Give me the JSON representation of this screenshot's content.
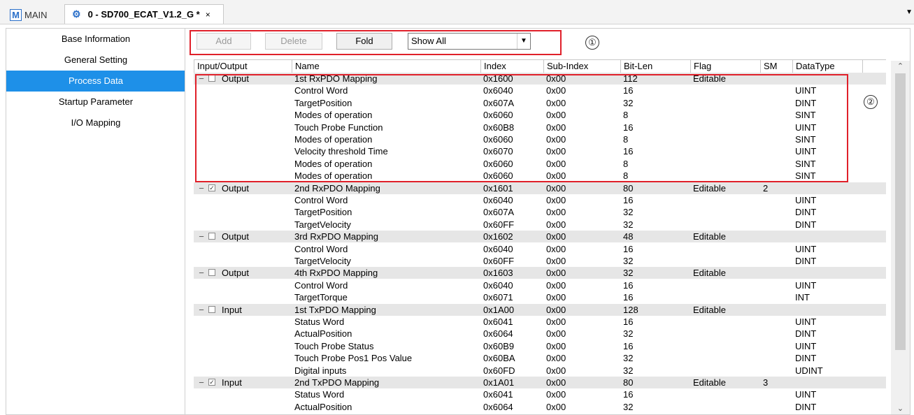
{
  "tabs": {
    "main_label": "MAIN",
    "active_label": "0 - SD700_ECAT_V1.2_G *",
    "close_glyph": "×"
  },
  "sidebar": {
    "items": [
      {
        "label": "Base Information",
        "active": false
      },
      {
        "label": "General Setting",
        "active": false
      },
      {
        "label": "Process Data",
        "active": true
      },
      {
        "label": "Startup Parameter",
        "active": false
      },
      {
        "label": "I/O Mapping",
        "active": false
      }
    ]
  },
  "toolbar": {
    "add_label": "Add",
    "delete_label": "Delete",
    "fold_label": "Fold",
    "filter_value": "Show All"
  },
  "markers": {
    "one": "①",
    "two": "②"
  },
  "accent_color": "#1e90e8",
  "highlight_color": "#e0202a",
  "table": {
    "columns": [
      "Input/Output",
      "Name",
      "Index",
      "Sub-Index",
      "Bit-Len",
      "Flag",
      "SM",
      "DataType"
    ],
    "rows": [
      {
        "group": true,
        "checked": false,
        "io": "Output",
        "name": "1st RxPDO Mapping",
        "index": "0x1600",
        "sub": "0x00",
        "bits": "112",
        "flag": "Editable",
        "sm": "",
        "type": ""
      },
      {
        "group": false,
        "io": "",
        "name": "Control Word",
        "index": "0x6040",
        "sub": "0x00",
        "bits": "16",
        "flag": "",
        "sm": "",
        "type": "UINT"
      },
      {
        "group": false,
        "io": "",
        "name": "TargetPosition",
        "index": "0x607A",
        "sub": "0x00",
        "bits": "32",
        "flag": "",
        "sm": "",
        "type": "DINT"
      },
      {
        "group": false,
        "io": "",
        "name": "Modes of operation",
        "index": "0x6060",
        "sub": "0x00",
        "bits": "8",
        "flag": "",
        "sm": "",
        "type": "SINT"
      },
      {
        "group": false,
        "io": "",
        "name": "Touch Probe Function",
        "index": "0x60B8",
        "sub": "0x00",
        "bits": "16",
        "flag": "",
        "sm": "",
        "type": "UINT"
      },
      {
        "group": false,
        "io": "",
        "name": "Modes of operation",
        "index": "0x6060",
        "sub": "0x00",
        "bits": "8",
        "flag": "",
        "sm": "",
        "type": "SINT"
      },
      {
        "group": false,
        "io": "",
        "name": "Velocity threshold Time",
        "index": "0x6070",
        "sub": "0x00",
        "bits": "16",
        "flag": "",
        "sm": "",
        "type": "UINT"
      },
      {
        "group": false,
        "io": "",
        "name": "Modes of operation",
        "index": "0x6060",
        "sub": "0x00",
        "bits": "8",
        "flag": "",
        "sm": "",
        "type": "SINT"
      },
      {
        "group": false,
        "io": "",
        "name": "Modes of operation",
        "index": "0x6060",
        "sub": "0x00",
        "bits": "8",
        "flag": "",
        "sm": "",
        "type": "SINT"
      },
      {
        "group": true,
        "checked": true,
        "io": "Output",
        "name": "2nd RxPDO Mapping",
        "index": "0x1601",
        "sub": "0x00",
        "bits": "80",
        "flag": "Editable",
        "sm": "2",
        "type": ""
      },
      {
        "group": false,
        "io": "",
        "name": "Control Word",
        "index": "0x6040",
        "sub": "0x00",
        "bits": "16",
        "flag": "",
        "sm": "",
        "type": "UINT"
      },
      {
        "group": false,
        "io": "",
        "name": "TargetPosition",
        "index": "0x607A",
        "sub": "0x00",
        "bits": "32",
        "flag": "",
        "sm": "",
        "type": "DINT"
      },
      {
        "group": false,
        "io": "",
        "name": "TargetVelocity",
        "index": "0x60FF",
        "sub": "0x00",
        "bits": "32",
        "flag": "",
        "sm": "",
        "type": "DINT"
      },
      {
        "group": true,
        "checked": false,
        "io": "Output",
        "name": "3rd RxPDO Mapping",
        "index": "0x1602",
        "sub": "0x00",
        "bits": "48",
        "flag": "Editable",
        "sm": "",
        "type": ""
      },
      {
        "group": false,
        "io": "",
        "name": "Control Word",
        "index": "0x6040",
        "sub": "0x00",
        "bits": "16",
        "flag": "",
        "sm": "",
        "type": "UINT"
      },
      {
        "group": false,
        "io": "",
        "name": "TargetVelocity",
        "index": "0x60FF",
        "sub": "0x00",
        "bits": "32",
        "flag": "",
        "sm": "",
        "type": "DINT"
      },
      {
        "group": true,
        "checked": false,
        "io": "Output",
        "name": "4th RxPDO Mapping",
        "index": "0x1603",
        "sub": "0x00",
        "bits": "32",
        "flag": "Editable",
        "sm": "",
        "type": ""
      },
      {
        "group": false,
        "io": "",
        "name": "Control Word",
        "index": "0x6040",
        "sub": "0x00",
        "bits": "16",
        "flag": "",
        "sm": "",
        "type": "UINT"
      },
      {
        "group": false,
        "io": "",
        "name": "TargetTorque",
        "index": "0x6071",
        "sub": "0x00",
        "bits": "16",
        "flag": "",
        "sm": "",
        "type": "INT"
      },
      {
        "group": true,
        "checked": false,
        "io": "Input",
        "name": "1st TxPDO Mapping",
        "index": "0x1A00",
        "sub": "0x00",
        "bits": "128",
        "flag": "Editable",
        "sm": "",
        "type": ""
      },
      {
        "group": false,
        "io": "",
        "name": "Status Word",
        "index": "0x6041",
        "sub": "0x00",
        "bits": "16",
        "flag": "",
        "sm": "",
        "type": "UINT"
      },
      {
        "group": false,
        "io": "",
        "name": "ActualPosition",
        "index": "0x6064",
        "sub": "0x00",
        "bits": "32",
        "flag": "",
        "sm": "",
        "type": "DINT"
      },
      {
        "group": false,
        "io": "",
        "name": "Touch Probe Status",
        "index": "0x60B9",
        "sub": "0x00",
        "bits": "16",
        "flag": "",
        "sm": "",
        "type": "UINT"
      },
      {
        "group": false,
        "io": "",
        "name": "Touch Probe Pos1 Pos Value",
        "index": "0x60BA",
        "sub": "0x00",
        "bits": "32",
        "flag": "",
        "sm": "",
        "type": "DINT"
      },
      {
        "group": false,
        "io": "",
        "name": "Digital inputs",
        "index": "0x60FD",
        "sub": "0x00",
        "bits": "32",
        "flag": "",
        "sm": "",
        "type": "UDINT"
      },
      {
        "group": true,
        "checked": true,
        "io": "Input",
        "name": "2nd TxPDO Mapping",
        "index": "0x1A01",
        "sub": "0x00",
        "bits": "80",
        "flag": "Editable",
        "sm": "3",
        "type": ""
      },
      {
        "group": false,
        "io": "",
        "name": "Status Word",
        "index": "0x6041",
        "sub": "0x00",
        "bits": "16",
        "flag": "",
        "sm": "",
        "type": "UINT"
      },
      {
        "group": false,
        "io": "",
        "name": "ActualPosition",
        "index": "0x6064",
        "sub": "0x00",
        "bits": "32",
        "flag": "",
        "sm": "",
        "type": "DINT"
      }
    ]
  }
}
